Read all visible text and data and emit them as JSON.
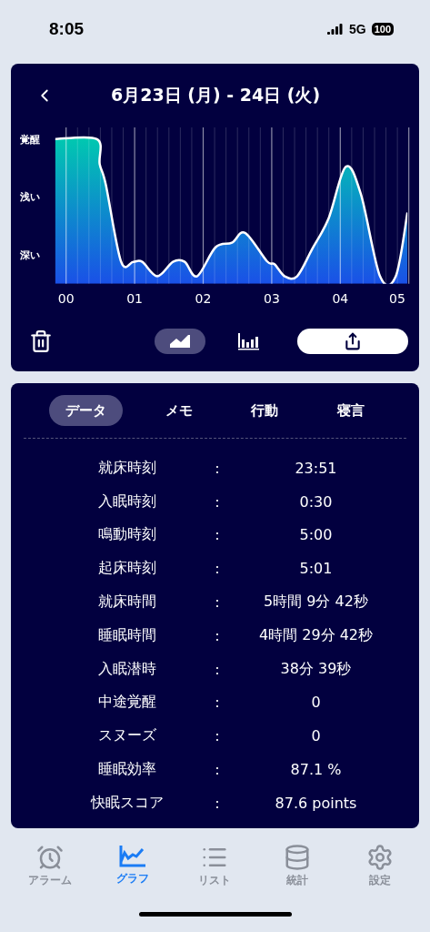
{
  "status_bar": {
    "time": "8:05",
    "network": "5G",
    "battery": "100"
  },
  "header": {
    "title": "6月23日 (月) - 24日 (火)"
  },
  "chart": {
    "y_labels": [
      "覚醒",
      "浅い",
      "深い"
    ],
    "x_labels": [
      "00",
      "01",
      "02",
      "03",
      "04",
      "05"
    ]
  },
  "toolbar": {
    "views": [
      {
        "kind": "line",
        "selected": true
      },
      {
        "kind": "bar",
        "selected": false
      }
    ]
  },
  "tabs": [
    {
      "label": "データ",
      "selected": true
    },
    {
      "label": "メモ",
      "selected": false
    },
    {
      "label": "行動",
      "selected": false
    },
    {
      "label": "寝言",
      "selected": false
    }
  ],
  "rows": [
    {
      "label": "就床時刻",
      "colon": ":",
      "value": "23:51"
    },
    {
      "label": "入眠時刻",
      "colon": ":",
      "value": "0:30"
    },
    {
      "label": "鳴動時刻",
      "colon": ":",
      "value": "5:00"
    },
    {
      "label": "起床時刻",
      "colon": ":",
      "value": "5:01"
    },
    {
      "label": "就床時間",
      "colon": ":",
      "value": "5時間 9分 42秒"
    },
    {
      "label": "睡眠時間",
      "colon": ":",
      "value": "4時間 29分 42秒"
    },
    {
      "label": "入眠潜時",
      "colon": ":",
      "value": "38分 39秒"
    },
    {
      "label": "中途覚醒",
      "colon": ":",
      "value": "0"
    },
    {
      "label": "スヌーズ",
      "colon": ":",
      "value": "0"
    },
    {
      "label": "睡眠効率",
      "colon": ":",
      "value": "87.1 %"
    },
    {
      "label": "快眠スコア",
      "colon": ":",
      "value": "87.6 points"
    }
  ],
  "nav": [
    {
      "kind": "alarm",
      "label": "アラーム",
      "selected": false
    },
    {
      "kind": "graph",
      "label": "グラフ",
      "selected": true
    },
    {
      "kind": "list",
      "label": "リスト",
      "selected": false
    },
    {
      "kind": "stats",
      "label": "統計",
      "selected": false
    },
    {
      "kind": "settings",
      "label": "設定",
      "selected": false
    }
  ]
}
